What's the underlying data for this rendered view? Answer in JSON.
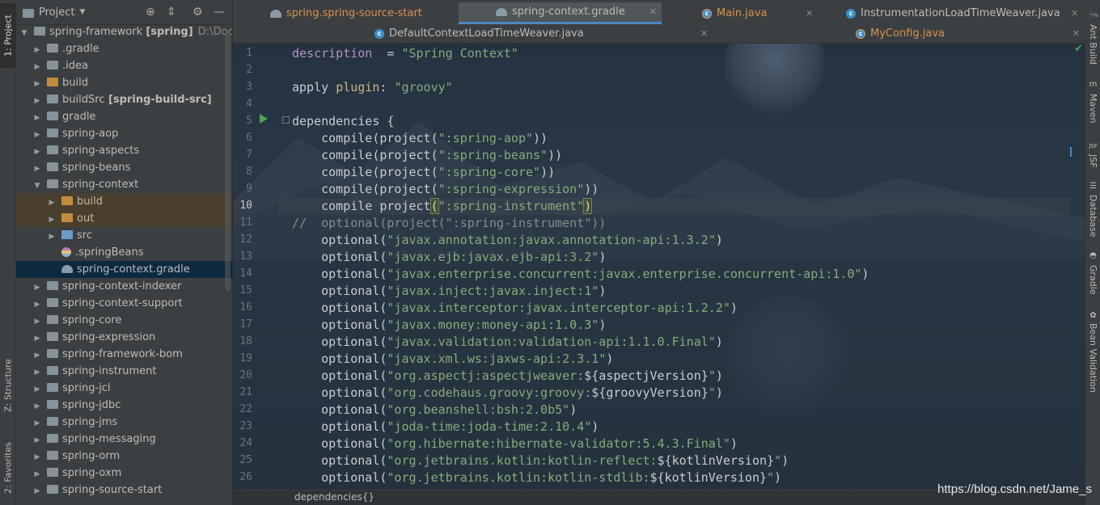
{
  "left_strip": {
    "project_tab": "1: Project",
    "structure_tab": "Z: Structure",
    "favorites_tab": "2: Favorites"
  },
  "project_panel": {
    "title": "Project",
    "root": {
      "name": "spring-framework",
      "module": "[spring]",
      "path": "D:\\Docume"
    },
    "items": [
      {
        "label": ".gradle",
        "kind": "folder"
      },
      {
        "label": ".idea",
        "kind": "folder"
      },
      {
        "label": "build",
        "kind": "folder-excluded"
      },
      {
        "label": "buildSrc",
        "bold": "[spring-build-src]",
        "kind": "folder"
      },
      {
        "label": "gradle",
        "kind": "folder"
      },
      {
        "label": "spring-aop",
        "kind": "folder"
      },
      {
        "label": "spring-aspects",
        "kind": "folder"
      },
      {
        "label": "spring-beans",
        "kind": "folder"
      },
      {
        "label": "spring-context",
        "kind": "folder-open"
      },
      {
        "label": "build",
        "kind": "sub-excluded"
      },
      {
        "label": "out",
        "kind": "sub-excluded"
      },
      {
        "label": "src",
        "kind": "sub-folder"
      },
      {
        "label": ".springBeans",
        "kind": "sub-file"
      },
      {
        "label": "spring-context.gradle",
        "kind": "sub-file-selected"
      },
      {
        "label": "spring-context-indexer",
        "kind": "folder"
      },
      {
        "label": "spring-context-support",
        "kind": "folder"
      },
      {
        "label": "spring-core",
        "kind": "folder"
      },
      {
        "label": "spring-expression",
        "kind": "folder"
      },
      {
        "label": "spring-framework-bom",
        "kind": "folder"
      },
      {
        "label": "spring-instrument",
        "kind": "folder"
      },
      {
        "label": "spring-jcl",
        "kind": "folder"
      },
      {
        "label": "spring-jdbc",
        "kind": "folder"
      },
      {
        "label": "spring-jms",
        "kind": "folder"
      },
      {
        "label": "spring-messaging",
        "kind": "folder"
      },
      {
        "label": "spring-orm",
        "kind": "folder"
      },
      {
        "label": "spring-oxm",
        "kind": "folder"
      },
      {
        "label": "spring-source-start",
        "kind": "folder"
      }
    ]
  },
  "tabs": {
    "row1": [
      {
        "label": "spring.spring-source-start",
        "icon": "gradle-icon",
        "active": false,
        "color": "#d6924c"
      },
      {
        "label": "spring-context.gradle",
        "icon": "gradle-icon",
        "active": true,
        "color": "#bbbbbb"
      },
      {
        "label": "Main.java",
        "icon": "java-class-icon",
        "active": false,
        "color": "#d6924c"
      },
      {
        "label": "InstrumentationLoadTimeWeaver.java",
        "icon": "java-class-icon",
        "active": false,
        "color": "#bbbbbb"
      }
    ],
    "row2": [
      {
        "label": "DefaultContextLoadTimeWeaver.java",
        "icon": "java-class-icon",
        "active": false,
        "color": "#bbbbbb"
      },
      {
        "label": "MyConfig.java",
        "icon": "java-class-icon",
        "active": false,
        "color": "#d6924c"
      }
    ]
  },
  "editor": {
    "current_line": 10,
    "lines": [
      {
        "n": "1",
        "parts": [
          [
            "prop",
            "description"
          ],
          [
            "",
            "  = "
          ],
          [
            "str",
            "\"Spring Context\""
          ]
        ]
      },
      {
        "n": "2",
        "parts": []
      },
      {
        "n": "3",
        "parts": [
          [
            "",
            "apply "
          ],
          [
            "kw",
            "plugin"
          ],
          [
            "",
            ": "
          ],
          [
            "str",
            "\"groovy\""
          ]
        ]
      },
      {
        "n": "4",
        "parts": []
      },
      {
        "n": "5",
        "parts": [
          [
            "",
            "dependencies {"
          ]
        ]
      },
      {
        "n": "6",
        "parts": [
          [
            "",
            "    compile(project("
          ],
          [
            "str",
            "\":spring-aop\""
          ],
          [
            "",
            "))"
          ]
        ]
      },
      {
        "n": "7",
        "parts": [
          [
            "",
            "    compile(project("
          ],
          [
            "str",
            "\":spring-beans\""
          ],
          [
            "",
            "))"
          ]
        ]
      },
      {
        "n": "8",
        "parts": [
          [
            "",
            "    compile(project("
          ],
          [
            "str",
            "\":spring-core\""
          ],
          [
            "",
            "))"
          ]
        ]
      },
      {
        "n": "9",
        "parts": [
          [
            "",
            "    compile(project("
          ],
          [
            "str",
            "\":spring-expression\""
          ],
          [
            "",
            "))"
          ]
        ]
      },
      {
        "n": "10",
        "parts": [
          [
            "",
            "    compile project"
          ],
          [
            "hi",
            "("
          ],
          [
            "str",
            "\":spring-instrument\""
          ],
          [
            "hi",
            ")"
          ]
        ]
      },
      {
        "n": "11",
        "parts": [
          [
            "cmt",
            "//  optional(project(\":spring-instrument\"))"
          ]
        ]
      },
      {
        "n": "12",
        "parts": [
          [
            "",
            "    optional("
          ],
          [
            "str",
            "\"javax.annotation:javax.annotation-api:1.3.2\""
          ],
          [
            "",
            ")"
          ]
        ]
      },
      {
        "n": "13",
        "parts": [
          [
            "",
            "    optional("
          ],
          [
            "str",
            "\"javax.ejb:javax.ejb-api:3.2\""
          ],
          [
            "",
            ")"
          ]
        ]
      },
      {
        "n": "14",
        "parts": [
          [
            "",
            "    optional("
          ],
          [
            "str",
            "\"javax.enterprise.concurrent:javax.enterprise.concurrent-api:1.0\""
          ],
          [
            "",
            ")"
          ]
        ]
      },
      {
        "n": "15",
        "parts": [
          [
            "",
            "    optional("
          ],
          [
            "str",
            "\"javax.inject:javax.inject:1\""
          ],
          [
            "",
            ")"
          ]
        ]
      },
      {
        "n": "16",
        "parts": [
          [
            "",
            "    optional("
          ],
          [
            "str",
            "\"javax.interceptor:javax.interceptor-api:1.2.2\""
          ],
          [
            "",
            ")"
          ]
        ]
      },
      {
        "n": "17",
        "parts": [
          [
            "",
            "    optional("
          ],
          [
            "str",
            "\"javax.money:money-api:1.0.3\""
          ],
          [
            "",
            ")"
          ]
        ]
      },
      {
        "n": "18",
        "parts": [
          [
            "",
            "    optional("
          ],
          [
            "str",
            "\"javax.validation:validation-api:1.1.0.Final\""
          ],
          [
            "",
            ")"
          ]
        ]
      },
      {
        "n": "19",
        "parts": [
          [
            "",
            "    optional("
          ],
          [
            "str",
            "\"javax.xml.ws:jaxws-api:2.3.1\""
          ],
          [
            "",
            ")"
          ]
        ]
      },
      {
        "n": "20",
        "parts": [
          [
            "",
            "    optional("
          ],
          [
            "str",
            "\"org.aspectj:aspectjweaver:"
          ],
          [
            "",
            "${aspectjVersion}"
          ],
          [
            "str",
            "\""
          ],
          [
            "",
            ")"
          ]
        ]
      },
      {
        "n": "21",
        "parts": [
          [
            "",
            "    optional("
          ],
          [
            "str",
            "\"org.codehaus.groovy:groovy:"
          ],
          [
            "",
            "${groovyVersion}"
          ],
          [
            "str",
            "\""
          ],
          [
            "",
            ")"
          ]
        ]
      },
      {
        "n": "22",
        "parts": [
          [
            "",
            "    optional("
          ],
          [
            "str",
            "\"org.beanshell:bsh:2.0b5\""
          ],
          [
            "",
            ")"
          ]
        ]
      },
      {
        "n": "23",
        "parts": [
          [
            "",
            "    optional("
          ],
          [
            "str",
            "\"joda-time:joda-time:2.10.4\""
          ],
          [
            "",
            ")"
          ]
        ]
      },
      {
        "n": "24",
        "parts": [
          [
            "",
            "    optional("
          ],
          [
            "str",
            "\"org.hibernate:hibernate-validator:5.4.3.Final\""
          ],
          [
            "",
            ")"
          ]
        ]
      },
      {
        "n": "25",
        "parts": [
          [
            "",
            "    optional("
          ],
          [
            "str",
            "\"org.jetbrains.kotlin:kotlin-reflect:"
          ],
          [
            "",
            "${kotlinVersion}"
          ],
          [
            "str",
            "\""
          ],
          [
            "",
            ")"
          ]
        ]
      },
      {
        "n": "26",
        "parts": [
          [
            "",
            "    optional("
          ],
          [
            "str",
            "\"org.jetbrains.kotlin:kotlin-stdlib:"
          ],
          [
            "",
            "${kotlinVersion}"
          ],
          [
            "str",
            "\""
          ],
          [
            "",
            ")"
          ]
        ]
      }
    ]
  },
  "breadcrumb": "dependencies{}",
  "watermark": "https://blog.csdn.net/Jame_s",
  "right_strip": {
    "ant": "Ant Build",
    "maven": "Maven",
    "jsf": "JSF",
    "database": "Database",
    "gradle": "Gradle",
    "bean_validation": "Bean Validation"
  }
}
